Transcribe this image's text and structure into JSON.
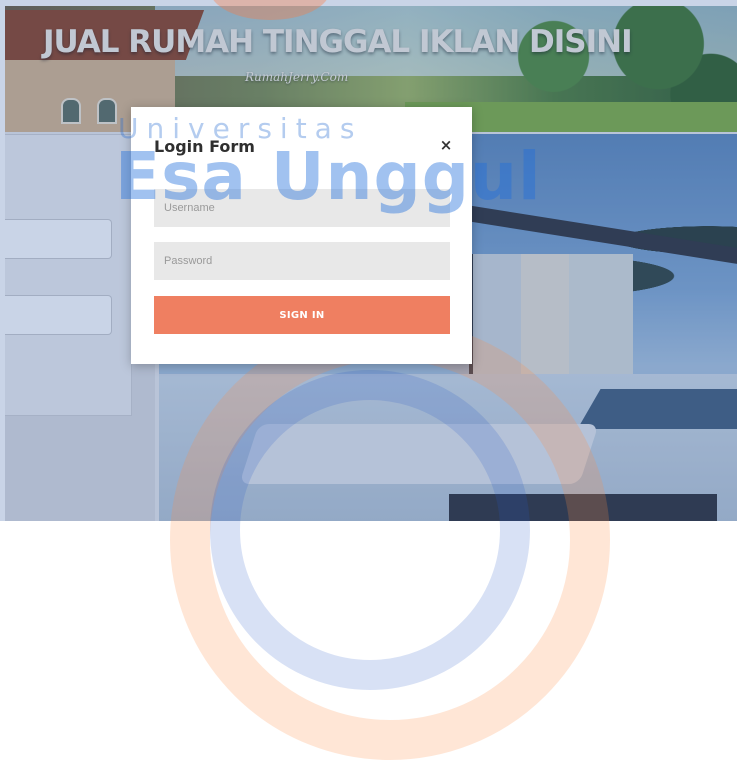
{
  "banner": {
    "title": "JUAL RUMAH TINGGAL IKLAN DISINI",
    "subtitle": "RumahJerry.Com"
  },
  "watermark": {
    "small_text": "Universitas",
    "big_text": "Esa Unggul"
  },
  "modal": {
    "title": "Login Form",
    "close_label": "×",
    "username_placeholder": "Username",
    "password_placeholder": "Password",
    "signin_label": "SIGN IN",
    "accent_color": "#ef7f61"
  }
}
